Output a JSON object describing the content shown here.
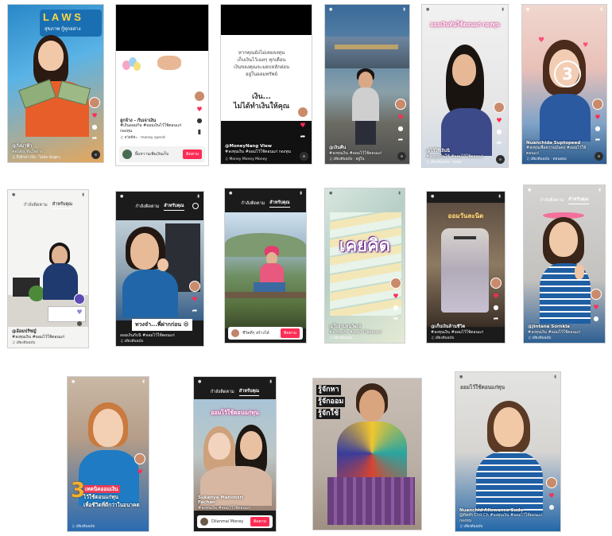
{
  "grid": {
    "shot1": {
      "sign": "L A W S",
      "sub": "สุขภาพ กู้ทุกอย่าง",
      "caption_user": "@กิ่งมาฟ้า",
      "caption": "คอนทุน ทันใจฝาก",
      "music": "♫ กิ่งฟ้ามา เงิน · ไม่ต่อ นั่นสุดๆ"
    },
    "shot2": {
      "caption_user": "ลูกจ้าง - กับเจาเงิน",
      "caption": "#เงินออมกัน #ออมเงินไว้ใช้ตอนแก่ กองทุน",
      "music": "♫ สวัสดีค่ะ · money spend",
      "user": "ยิ้มหวานเพิ่มเงินเก็บ",
      "follow": "ติดตาม"
    },
    "shot3": {
      "text1": "หากคุณยังไม่เคยลงทุน",
      "text2": "เก็บเงินไว้เฉยๆ ทุกเดือน",
      "text3": "เงินของคุณจะมอบหลักผ่อน",
      "text4": "อยู่ในออมทรัพย์",
      "headline1": "เงิน...",
      "headline2": "ไม่ได้ทำเงินให้คุณ",
      "caption_user": "@MoneyNang View",
      "caption": "#ลงทุนเงิน #ออมไว้ใช้ตอนแก่ กองทุน",
      "music": "♫ Money Money Money"
    },
    "shot4": {
      "caption_user": "@เงินคืน",
      "caption": "#ลงทุนเงิน #ออมไว้ใช้ตอนแก่",
      "music": "♫ เสียงต้นฉบับ · อยู่ใน"
    },
    "shot5": {
      "banner": "ออมเงินทันใช้ตอนแก่ กองทุน",
      "caption_user": "@ไว้ใช้เงินนิ",
      "caption": "#ลงทุนเงินใช้ #ออมไว้ใช้ตอนแก่",
      "music": "♫ เสียงต้นฉบับ · ลงทุน"
    },
    "shot6": {
      "badge": "3",
      "caption_user": "Nuanchida Suptopeed",
      "caption": "#ลงทุนเพื่อความมั่นคง #ออมไว้ใช้ตอนแก่",
      "music": "♫ เสียงต้นฉบับ · ตอนออม"
    },
    "shot7": {
      "tab_following": "กำลังติดตาม",
      "tab_foryou": "สำหรับคุณ",
      "caption_user": "@อ้อมปรัชญ์",
      "caption": "#ลงทุนเงิน #ออมไว้ใช้ตอนแก่",
      "music": "♫ เสียงต้นฉบับ"
    },
    "shot8": {
      "tab_following": "กำลังติดตาม",
      "tab_foryou": "สำหรับคุณ",
      "sticker": "ทวงจ๋า...พี่ฝากก่อน 😆",
      "caption": "ออมเงินกับนิ #ออมไว้ใช้ตอนแก่",
      "music": "♫ เสียงต้นฉบับ"
    },
    "shot9": {
      "tab_following": "กำลังติดตาม",
      "tab_foryou": "สำหรับคุณ",
      "user": "ชีวิตดีๆ สร้างได้",
      "follow": "ติดตาม"
    },
    "shot10": {
      "headline": "เคยคิด",
      "caption_user": "@ใบงามธนวัฒน์",
      "caption": "#ลงทุนเงิน #ออมไว้ใช้ตอนแก่",
      "music": "♫ เสียงต้นฉบับ"
    },
    "shot11": {
      "banner": "ออมวันละนิด",
      "caption_user": "@เก็บเงินล้านชีวิต",
      "caption": "#ลงทุนเงิน #ออมไว้ใช้ตอนแก่",
      "music": "♫ เสียงต้นฉบับ"
    },
    "shot12": {
      "tab_following": "กำลังติดตาม",
      "tab_foryou": "สำหรับคุณ",
      "caption_user": "@Jintana Sornkla",
      "caption": "#ลงทุนเงิน #ออมไว้ใช้ตอนแก่",
      "music": "♫ เสียงต้นฉบับ"
    },
    "shot13": {
      "number": "3",
      "line1": "เทคนิคออมเงิน",
      "line2": "ไว้ใช้ตอนแก่ทุน",
      "line3": "เพื่อชีวิตที่ดีกว่าในอนาคต",
      "music": "♫ เสียงต้นฉบับ"
    },
    "shot14": {
      "banner": "ออมไว้ใช้ตอนแก่ทุน",
      "caption_user": "Sukanya Manonsri Fachan",
      "caption": "#ลงทุนเงิน #ออมไว้ใช้ตอนแก่",
      "user": "Dilanmai Money",
      "follow": "ติดตาม"
    },
    "shot15": {
      "line1": "รู้จักหา",
      "line2": "รู้จักออม",
      "line3": "รู้จักใช้"
    },
    "shot16": {
      "banner": "ออมไว้ใช้ตอนแก่ทุน",
      "caption_user": "Nuanchid Allowance Sudu",
      "caption": "@Neth Chit Ch #ลงทุนเงิน #ออมไว้ใช้ตอนแก่ กองทุน",
      "music": "♫ เสียงต้นฉบับ"
    }
  },
  "colors": {
    "tiktok_red": "#fe2c55",
    "pink_banner": "#e2458c",
    "dark": "#1b1b1b"
  }
}
